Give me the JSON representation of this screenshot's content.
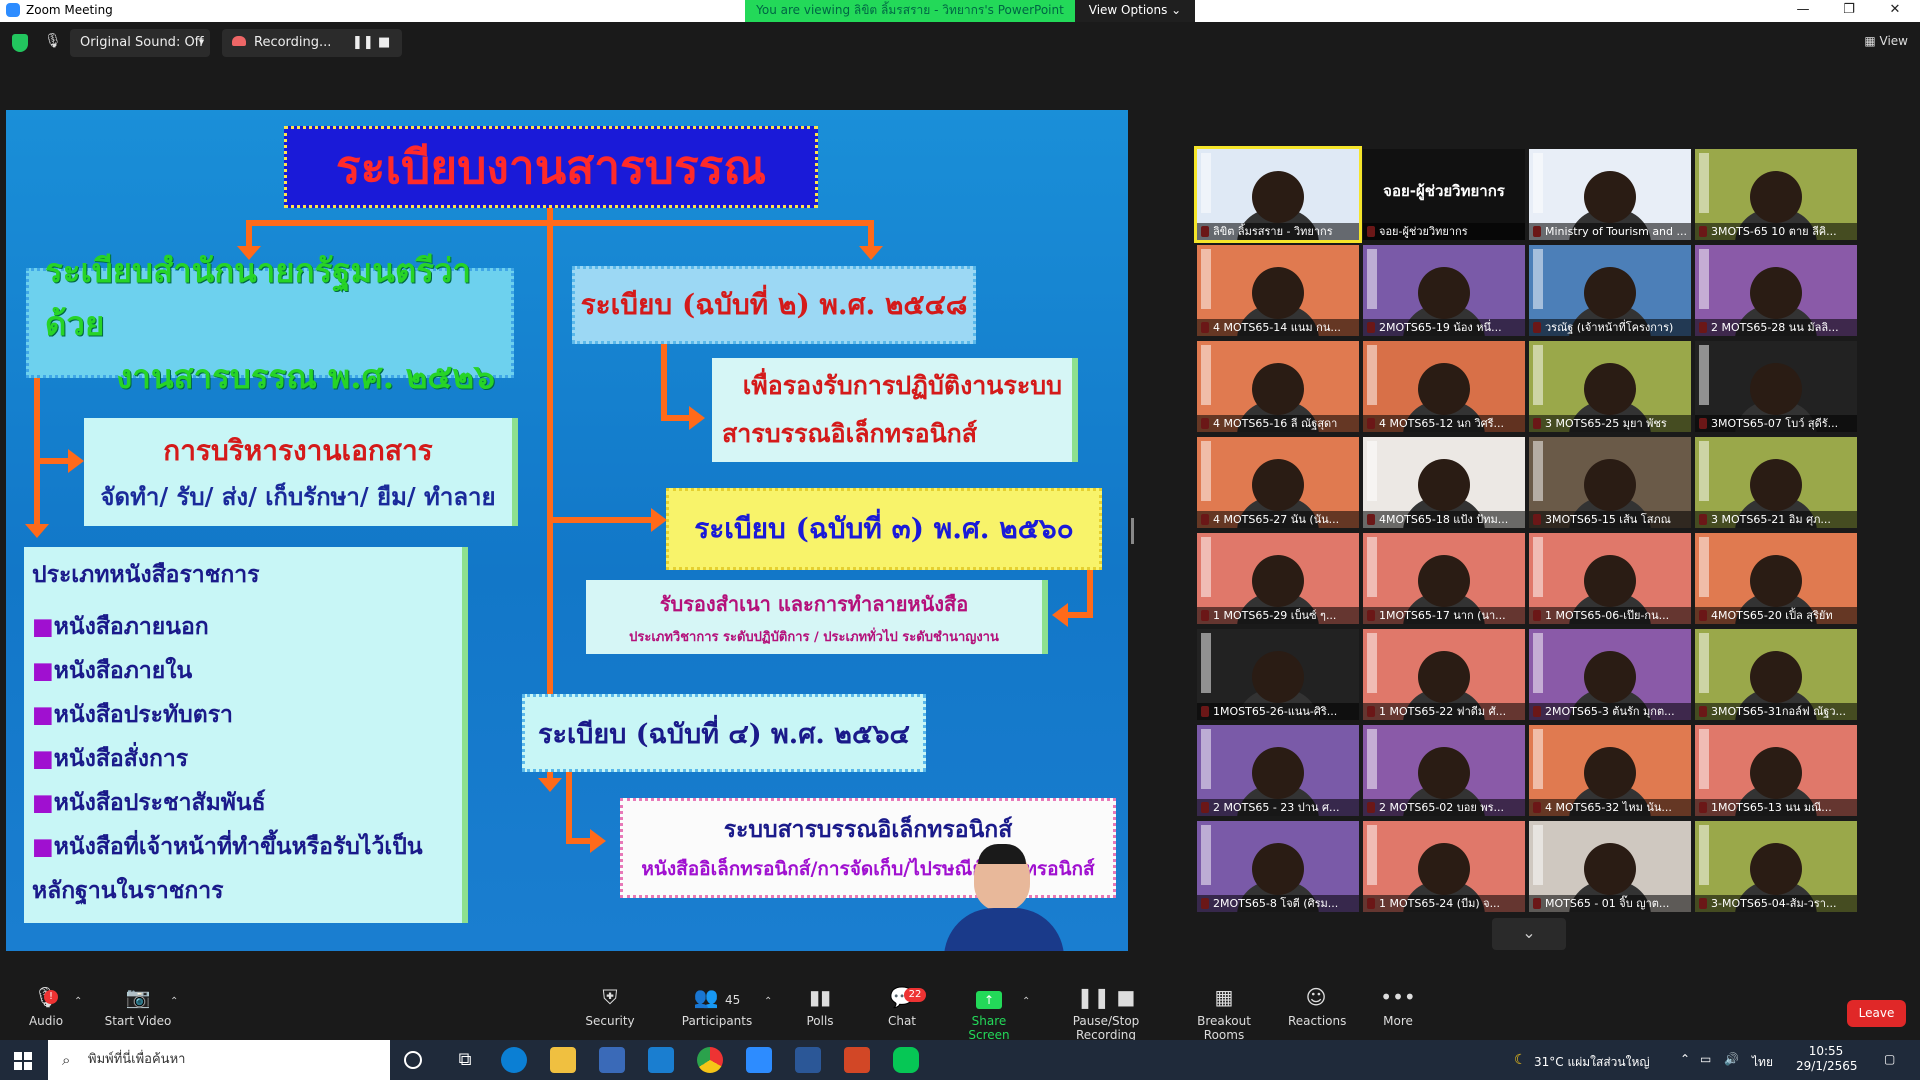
{
  "window": {
    "title": "Zoom Meeting",
    "banner": "You are viewing ลิขิต ลิ้มรสราย - วิทยากร's PowerPoint",
    "view_options": "View Options",
    "view_btn": "View"
  },
  "toolbar_top": {
    "original_sound": "Original Sound: Off",
    "recording": "Recording..."
  },
  "slide": {
    "title": "ระเบียบงานสารบรรณ",
    "box1_line1": "ระเบียบสำนักนายกรัฐมนตรีว่าด้วย",
    "box1_line2": "งานสารบรรณ พ.ศ. ๒๕๒๖",
    "box2": "ระเบียบ (ฉบับที่ ๒) พ.ศ. ๒๕๔๘",
    "box3_line1": "เพื่อรองรับการปฏิบัติงานระบบ",
    "box3_line2": "สารบรรณอิเล็กทรอนิกส์",
    "box4_title": "การบริหารงานเอกสาร",
    "box4_sub": "จัดทำ/ รับ/ ส่ง/ เก็บรักษา/ ยืม/ ทำลาย",
    "box5": "ระเบียบ (ฉบับที่ ๓) พ.ศ. ๒๕๖๐",
    "box6_line1": "รับรองสำเนา และการทำลายหนังสือ",
    "box6_line2": "ประเภทวิชาการ ระดับปฏิบัติการ / ประเภททั่วไป ระดับชำนาญงาน",
    "types_title": "ประเภทหนังสือราชการ",
    "types": [
      "หนังสือภายนอก",
      "หนังสือภายใน",
      "หนังสือประทับตรา",
      "หนังสือสั่งการ",
      "หนังสือประชาสัมพันธ์",
      "หนังสือที่เจ้าหน้าที่ทำขึ้นหรือรับไว้เป็น"
    ],
    "types_tail": "หลักฐานในราชการ",
    "box7": "ระเบียบ (ฉบับที่ ๔) พ.ศ. ๒๕๖๔",
    "box8_line1": "ระบบสารบรรณอิเล็กทรอนิกส์",
    "box8_line2": "หนังสืออิเล็กทรอนิกส์/การจัดเก็บ/ไปรษณีย์อิเล็กทรอนิกส์"
  },
  "gallery": [
    {
      "name": "ลิขิต ลิ้มรสราย - วิทยากร",
      "bg": "#dfe9f5",
      "active": true
    },
    {
      "name": "จอย-ผู้ช่วยวิทยากร",
      "bg": "#111111",
      "text": "จอย-ผู้ช่วยวิทยากร"
    },
    {
      "name": "Ministry of Tourism and ...",
      "bg": "#e8eef7"
    },
    {
      "name": "3MOTS-65 10 ตาย ลีคิ...",
      "bg": "#9aa84a"
    },
    {
      "name": "4 MOTS65-14 แนม กน...",
      "bg": "#e07a50"
    },
    {
      "name": "2MOTS65-19 น้อง หนึ่...",
      "bg": "#7a5aa8"
    },
    {
      "name": "วรณัฐ (เจ้าหน้าที่โครงการ)",
      "bg": "#4c7fb8"
    },
    {
      "name": "2 MOTS65-28 นน มัลลิ...",
      "bg": "#8a5aa8"
    },
    {
      "name": "4 MOTS65-16 ลี ณัฐสุดา",
      "bg": "#e07a50"
    },
    {
      "name": "4 MOTS65-12 นก วิศรี...",
      "bg": "#d87048"
    },
    {
      "name": "3 MOTS65-25 มุยา พัชร",
      "bg": "#9aa84a"
    },
    {
      "name": "3MOTS65-07 โบว์ สุดีรั...",
      "bg": "#222222"
    },
    {
      "name": "4 MOTS65-27 นัน (นัน...",
      "bg": "#e07a50"
    },
    {
      "name": "4MOTS65-18 แป้ง ปัทม...",
      "bg": "#ece8e4"
    },
    {
      "name": "3MOTS65-15 เส้น โสภณ",
      "bg": "#6a5a48"
    },
    {
      "name": "3 MOTS65-21 อิม ศุภ...",
      "bg": "#9aa84a"
    },
    {
      "name": "1 MOTS65-29 เบ็นซ์ ๆ...",
      "bg": "#e0786a"
    },
    {
      "name": "1MOTS65-17 นาก (นา...",
      "bg": "#e0786a"
    },
    {
      "name": "1 MOTS65-06-เป๊ย-กน...",
      "bg": "#e0786a"
    },
    {
      "name": "4MOTS65-20 เปิ้ล สุริยัท",
      "bg": "#e07a50"
    },
    {
      "name": "1MOST65-26-แนน-ศิริ...",
      "bg": "#222222"
    },
    {
      "name": "1 MOTS65-22 ฟาดีม ศั...",
      "bg": "#e0786a"
    },
    {
      "name": "2MOTS65-3 ต้นรัก มุกต...",
      "bg": "#8a5aa8"
    },
    {
      "name": "3MOTS65-31กอล์ฟ ณัฐว...",
      "bg": "#9aa84a"
    },
    {
      "name": "2 MOTS65 - 23 ปาน ศ...",
      "bg": "#7a5aa8"
    },
    {
      "name": "2 MOTS65-02 บอย พร...",
      "bg": "#8a5aa8"
    },
    {
      "name": "4 MOTS65-32 ไหม นัน...",
      "bg": "#e07a50"
    },
    {
      "name": "1MOTS65-13 นน มณี...",
      "bg": "#e0786a"
    },
    {
      "name": "2MOTS65-8 โจตี (ศิรม...",
      "bg": "#7a5aa8"
    },
    {
      "name": "1 MOTS65-24 (บีม) จ...",
      "bg": "#e0786a"
    },
    {
      "name": "MOTS65 - 01 จิ๊บ ญาต...",
      "bg": "#cfc8c0"
    },
    {
      "name": "3-MOTS65-04-ส้ม-วรา...",
      "bg": "#9aa84a"
    }
  ],
  "controls": {
    "audio": "Audio",
    "start_video": "Start Video",
    "security": "Security",
    "participants": "Participants",
    "participants_count": "45",
    "polls": "Polls",
    "chat": "Chat",
    "chat_badge": "22",
    "share_screen": "Share Screen",
    "pause_recording": "Pause/Stop Recording",
    "breakout": "Breakout Rooms",
    "reactions": "Reactions",
    "more": "More",
    "leave": "Leave"
  },
  "taskbar": {
    "search_placeholder": "พิมพ์ที่นี่เพื่อค้นหา",
    "weather": "31°C แผ่มใสส่วนใหญ่",
    "lang": "ไทย",
    "time": "10:55",
    "date": "29/1/2565"
  }
}
